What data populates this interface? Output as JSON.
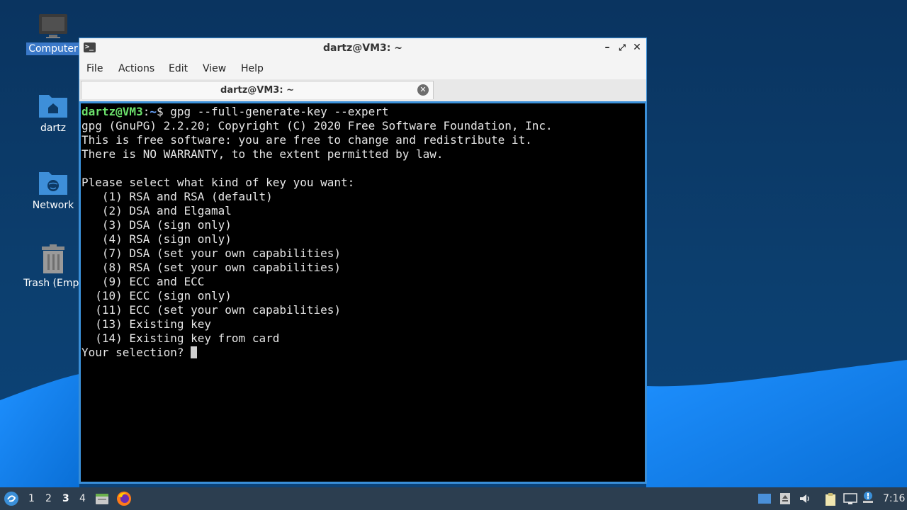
{
  "desktop": {
    "icons": [
      {
        "label": "Computer",
        "icon": "monitor-icon"
      },
      {
        "label": "dartz",
        "icon": "home-folder-icon"
      },
      {
        "label": "Network",
        "icon": "network-folder-icon"
      },
      {
        "label": "Trash (Empt",
        "icon": "trash-icon"
      }
    ]
  },
  "window": {
    "title": "dartz@VM3: ~",
    "menu": [
      "File",
      "Actions",
      "Edit",
      "View",
      "Help"
    ],
    "tab": {
      "label": "dartz@VM3: ~"
    }
  },
  "terminal": {
    "prompt_user": "dartz@VM3",
    "prompt_sep": ":",
    "prompt_path": "~",
    "prompt_dollar": "$ ",
    "command": "gpg --full-generate-key --expert",
    "lines": [
      "gpg (GnuPG) 2.2.20; Copyright (C) 2020 Free Software Foundation, Inc.",
      "This is free software: you are free to change and redistribute it.",
      "There is NO WARRANTY, to the extent permitted by law.",
      "",
      "Please select what kind of key you want:",
      "   (1) RSA and RSA (default)",
      "   (2) DSA and Elgamal",
      "   (3) DSA (sign only)",
      "   (4) RSA (sign only)",
      "   (7) DSA (set your own capabilities)",
      "   (8) RSA (set your own capabilities)",
      "   (9) ECC and ECC",
      "  (10) ECC (sign only)",
      "  (11) ECC (set your own capabilities)",
      "  (13) Existing key",
      "  (14) Existing key from card"
    ],
    "input_prompt": "Your selection? "
  },
  "taskbar": {
    "workspaces": [
      "1",
      "2",
      "3",
      "4"
    ],
    "active_workspace": "3",
    "clock": "7:16"
  },
  "colors": {
    "accent": "#3a8fd8",
    "terminal_bg": "#000000",
    "prompt_user": "#6be06b",
    "prompt_path": "#6aa6ff",
    "taskbar_bg": "#2c3e50"
  }
}
